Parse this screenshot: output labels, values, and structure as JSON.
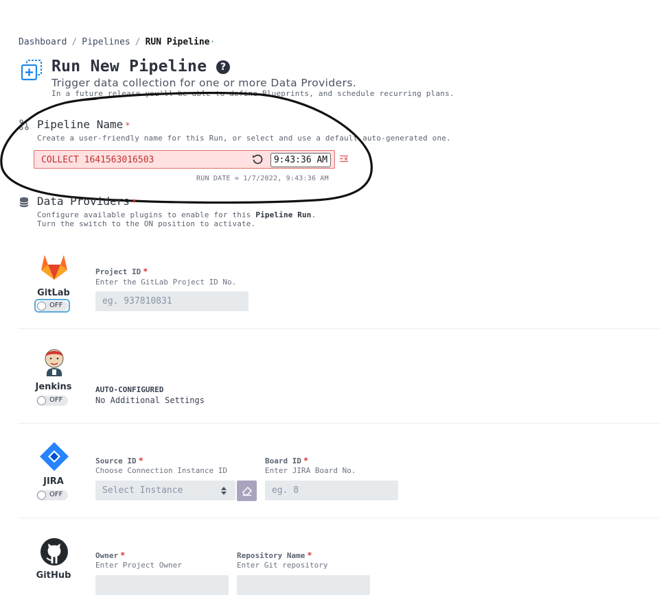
{
  "breadcrumb": {
    "items": [
      "Dashboard",
      "Pipelines"
    ],
    "separator": "/",
    "current": "RUN Pipeline",
    "current_marker": "·"
  },
  "header": {
    "title": "Run New Pipeline",
    "help_glyph": "?",
    "subtitle": "Trigger data collection for one or more Data Providers.",
    "note": "In a future release you'll be able to define Blueprints, and schedule recurring plans."
  },
  "pipeline_name": {
    "title": "Pipeline Name",
    "required_mark": "*",
    "description": "Create a user-friendly name for this Run, or select and use a default auto-generated one.",
    "value": "COLLECT 1641563016503",
    "time": "9:43:36 AM",
    "run_date": "RUN DATE = 1/7/2022, 9:43:36 AM"
  },
  "data_providers": {
    "title": "Data Providers",
    "required_mark": "*",
    "description_prefix": "Configure available plugins to enable for this ",
    "description_emphasis": "Pipeline Run",
    "description_suffix": ".",
    "description_line2": "Turn the switch to the ON position to activate."
  },
  "providers": {
    "gitlab": {
      "name": "GitLab",
      "toggle": "OFF",
      "field_label": "Project ID",
      "field_help": "Enter the GitLab Project ID No.",
      "placeholder": "eg. 937810831"
    },
    "jenkins": {
      "name": "Jenkins",
      "toggle": "OFF",
      "auto_label": "AUTO-CONFIGURED",
      "auto_sub": "No Additional Settings"
    },
    "jira": {
      "name": "JIRA",
      "toggle": "OFF",
      "source_label": "Source ID",
      "source_help": "Choose Connection Instance ID",
      "source_select": "Select Instance",
      "board_label": "Board ID",
      "board_help": "Enter JIRA Board No.",
      "board_placeholder": "eg. 8"
    },
    "github": {
      "name": "GitHub",
      "owner_label": "Owner",
      "owner_help": "Enter Project Owner",
      "repo_label": "Repository Name",
      "repo_help": "Enter Git repository"
    }
  },
  "colors": {
    "error_bg": "#ffe1e1",
    "error_border": "#e36a6a",
    "required": "#db3737",
    "focus": "#5aa9d9",
    "jira_blue": "#2684ff",
    "gitlab_orange": "#fc6d26"
  },
  "icons": [
    "add-pipeline-icon",
    "help-icon",
    "git-branch-icon",
    "refresh-icon",
    "clear-icon",
    "database-icon",
    "gitlab-logo-icon",
    "jenkins-logo-icon",
    "jira-logo-icon",
    "github-logo-icon",
    "select-arrows-icon",
    "eraser-icon"
  ]
}
